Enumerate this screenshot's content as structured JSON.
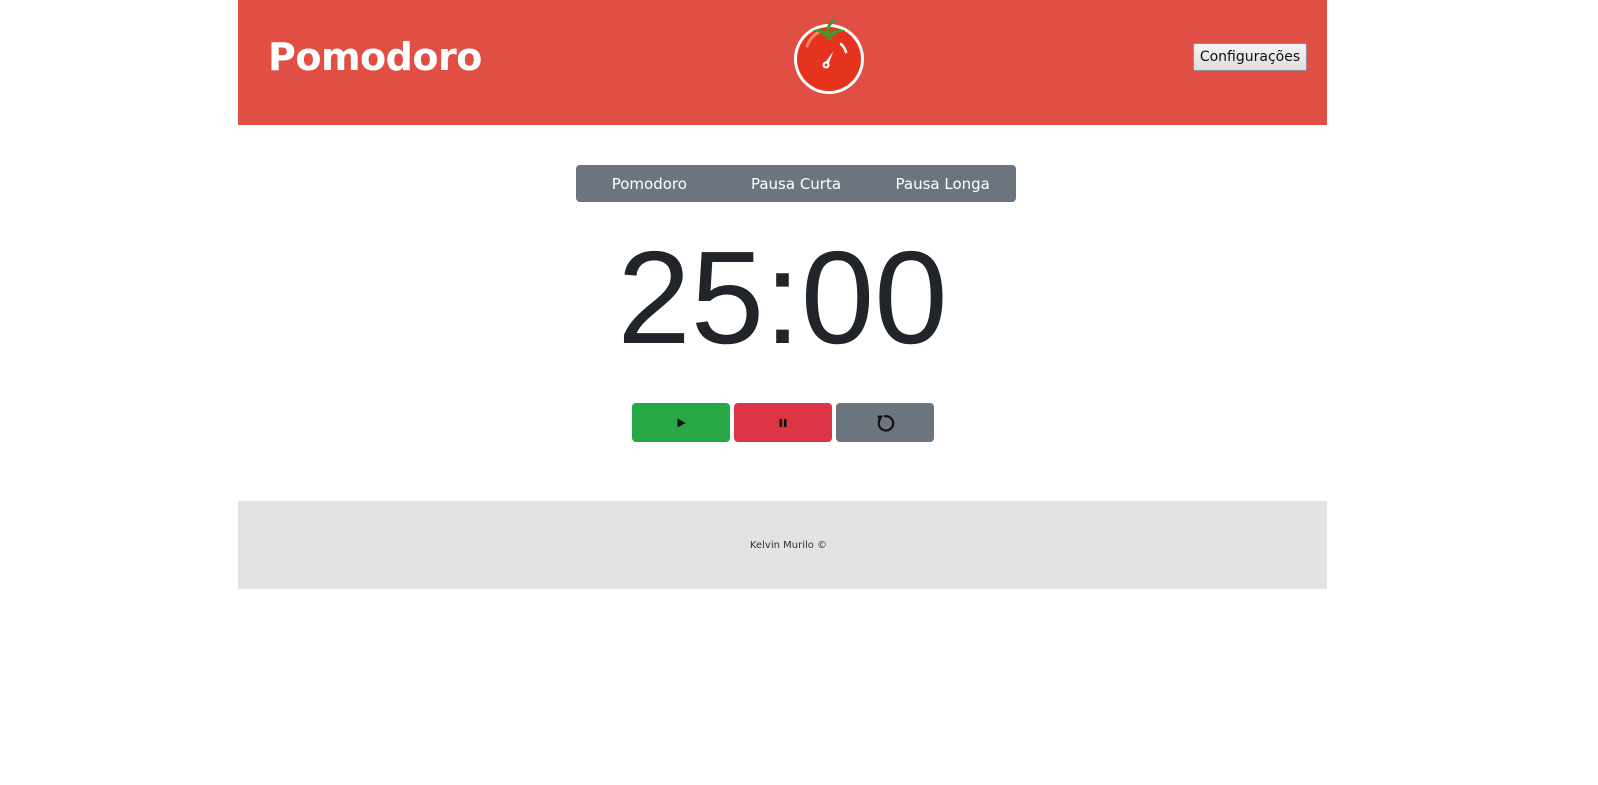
{
  "header": {
    "title": "Pomodoro",
    "logo_icon": "tomato-timer-icon",
    "settings_label": "Configurações",
    "background": "#e04e44"
  },
  "modes": [
    {
      "label": "Pomodoro"
    },
    {
      "label": "Pausa Curta"
    },
    {
      "label": "Pausa Longa"
    }
  ],
  "timer": {
    "display": "25:00"
  },
  "controls": [
    {
      "icon": "play-icon",
      "color": "#28a745"
    },
    {
      "icon": "pause-icon",
      "color": "#dc3545"
    },
    {
      "icon": "reset-icon",
      "color": "#6c757d"
    }
  ],
  "footer": {
    "credit": "Kelvin Murilo ©"
  }
}
